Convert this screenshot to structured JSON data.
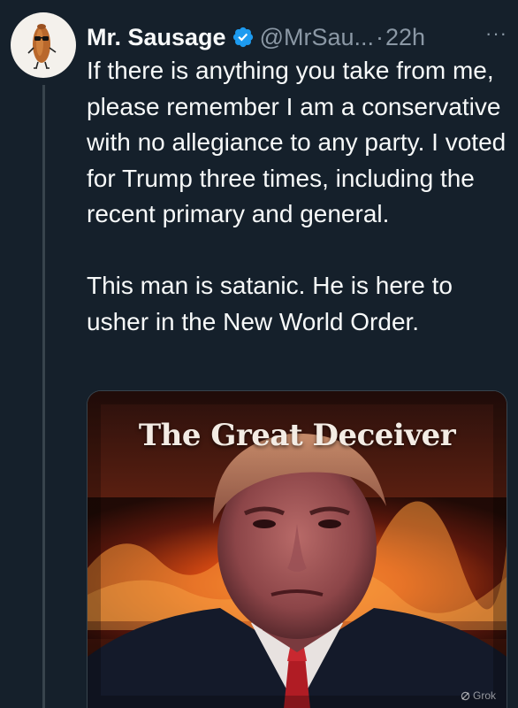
{
  "author": {
    "display_name": "Mr. Sausage",
    "handle": "@MrSau...",
    "separator": "·",
    "time": "22h",
    "verified": true,
    "avatar_icon": "sausage-mascot-icon"
  },
  "menu": {
    "more_label": "···"
  },
  "tweet": {
    "paragraph1": "If there is anything you take from me, please remember I am a conservative with no allegiance to any party.  I voted for Trump three times, including the recent primary and general.",
    "paragraph2": "This man is satanic.  He is here to usher in the New World Order."
  },
  "media": {
    "title": "The Great Deceiver",
    "watermark": "Grok"
  },
  "colors": {
    "background": "#15202b",
    "text": "#f7f9f9",
    "secondary": "#8b98a5",
    "verified": "#1d9bf0",
    "thread_line": "#38444d"
  }
}
